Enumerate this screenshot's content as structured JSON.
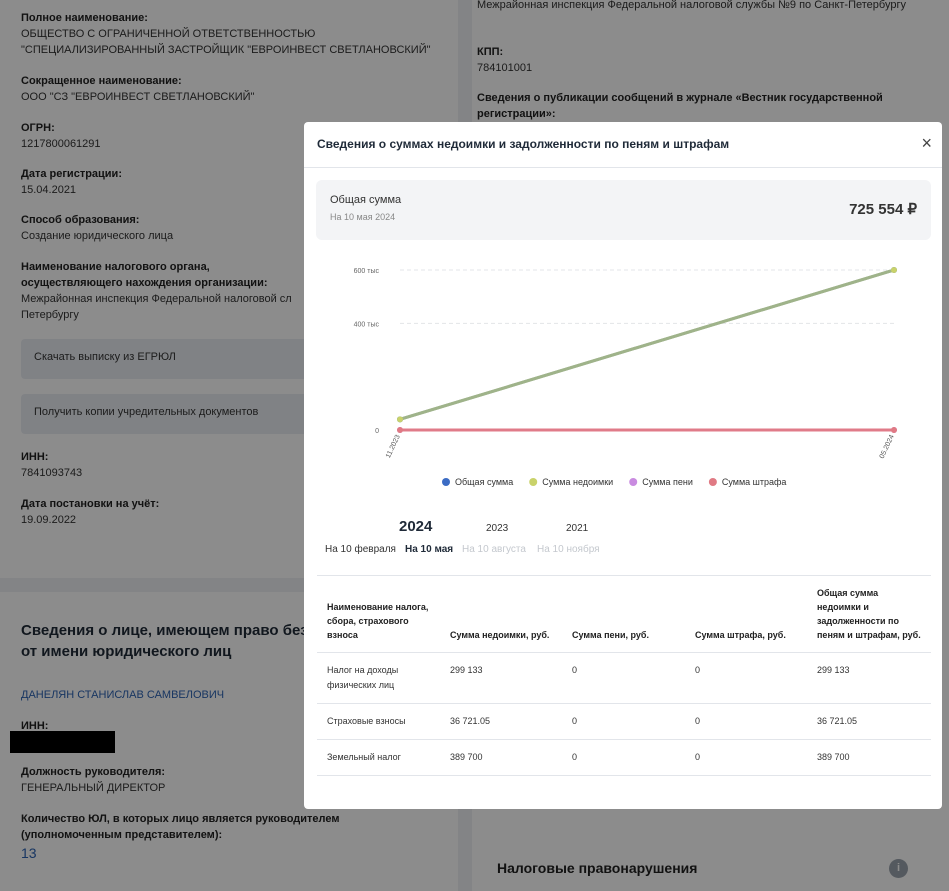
{
  "background": {
    "fields_left": [
      {
        "label": "Полное наименование:",
        "value": "ОБЩЕСТВО С ОГРАНИЧЕННОЙ ОТВЕТСТВЕННОСТЬЮ \"СПЕЦИАЛИЗИРОВАННЫЙ ЗАСТРОЙЩИК \"ЕВРОИНВЕСТ СВЕТЛАНОВСКИЙ\""
      },
      {
        "label": "Сокращенное наименование:",
        "value": "ООО \"СЗ \"ЕВРОИНВЕСТ СВЕТЛАНОВСКИЙ\""
      },
      {
        "label": "ОГРН:",
        "value": "1217800061291"
      },
      {
        "label": "Дата регистрации:",
        "value": "15.04.2021"
      },
      {
        "label": "Способ образования:",
        "value": "Создание юридического лица"
      },
      {
        "label": "Наименование налогового органа, осуществляющего нахождения организации:",
        "value": "Межрайонная инспекция Федеральной налоговой сл Петербургу"
      },
      {
        "label": "ИНН:",
        "value": "7841093743"
      },
      {
        "label": "Дата постановки на учёт:",
        "value": "19.09.2022"
      }
    ],
    "download_extract_button": "Скачать выписку из ЕГРЮЛ",
    "get_copies_button": "Получить копии учредительных документов",
    "right_top_text": "Межрайонная инспекция Федеральной налоговой службы №9 по Санкт-Петербургу",
    "kpp_label": "КПП:",
    "kpp_value": "784101001",
    "vestnik_label": "Сведения о публикации сообщений в журнале «Вестник государственной регистрации»:",
    "person_section_title": "Сведения о лице, имеющем право без до действовать от имени юридического лиц",
    "person_name": "ДАНЕЛЯН СТАНИСЛАВ САМВЕЛОВИЧ",
    "person_inn_label": "ИНН:",
    "position_label": "Должность руководителя:",
    "position_value": "ГЕНЕРАЛЬНЫЙ ДИРЕКТОР",
    "count_label": "Количество ЮЛ, в которых лицо является руководителем (уполномоченным представителем):",
    "count_value": "13",
    "tax_violations_title": "Налоговые правонарушения",
    "info_icon_glyph": "i"
  },
  "modal": {
    "title": "Сведения о суммах недоимки и задолженности по пеням и штрафам",
    "close_glyph": "×",
    "total_label": "Общая сумма",
    "total_date": "На 10 мая 2024",
    "total_amount": "725 554 ₽",
    "years": [
      "2024",
      "2023",
      "2021"
    ],
    "periods": [
      {
        "label": "На 10 февраля",
        "state": "normal"
      },
      {
        "label": "На 10 мая",
        "state": "selected"
      },
      {
        "label": "На 10 августа",
        "state": "disabled"
      },
      {
        "label": "На 10 ноября",
        "state": "disabled"
      }
    ],
    "table": {
      "headers": [
        "Наименование налога, сбора, страхового взноса",
        "Сумма недоимки, руб.",
        "Сумма пени, руб.",
        "Сумма штрафа, руб.",
        "Общая сумма недоимки и задолженности по пеням и штрафам, руб."
      ],
      "rows": [
        [
          "Налог на доходы физических лиц",
          "299 133",
          "0",
          "0",
          "299 133"
        ],
        [
          "Страховые взносы",
          "36 721.05",
          "0",
          "0",
          "36 721.05"
        ],
        [
          "Земельный налог",
          "389 700",
          "0",
          "0",
          "389 700"
        ]
      ]
    }
  },
  "chart_data": {
    "type": "line",
    "x": [
      "11.2023",
      "05.2024"
    ],
    "ytick_labels": [
      "0",
      "400 тыс",
      "600 тыс"
    ],
    "ylim": [
      0,
      600000
    ],
    "grid": true,
    "legend_position": "bottom",
    "series": [
      {
        "name": "Общая сумма",
        "color": "#3c6cc4",
        "values": [
          40000,
          725554
        ]
      },
      {
        "name": "Сумма недоимки",
        "color": "#c9d26a",
        "values": [
          40000,
          725554
        ]
      },
      {
        "name": "Сумма пени",
        "color": "#c98be0",
        "values": [
          0,
          0
        ]
      },
      {
        "name": "Сумма штрафа",
        "color": "#e07a84",
        "values": [
          0,
          0
        ]
      }
    ]
  }
}
